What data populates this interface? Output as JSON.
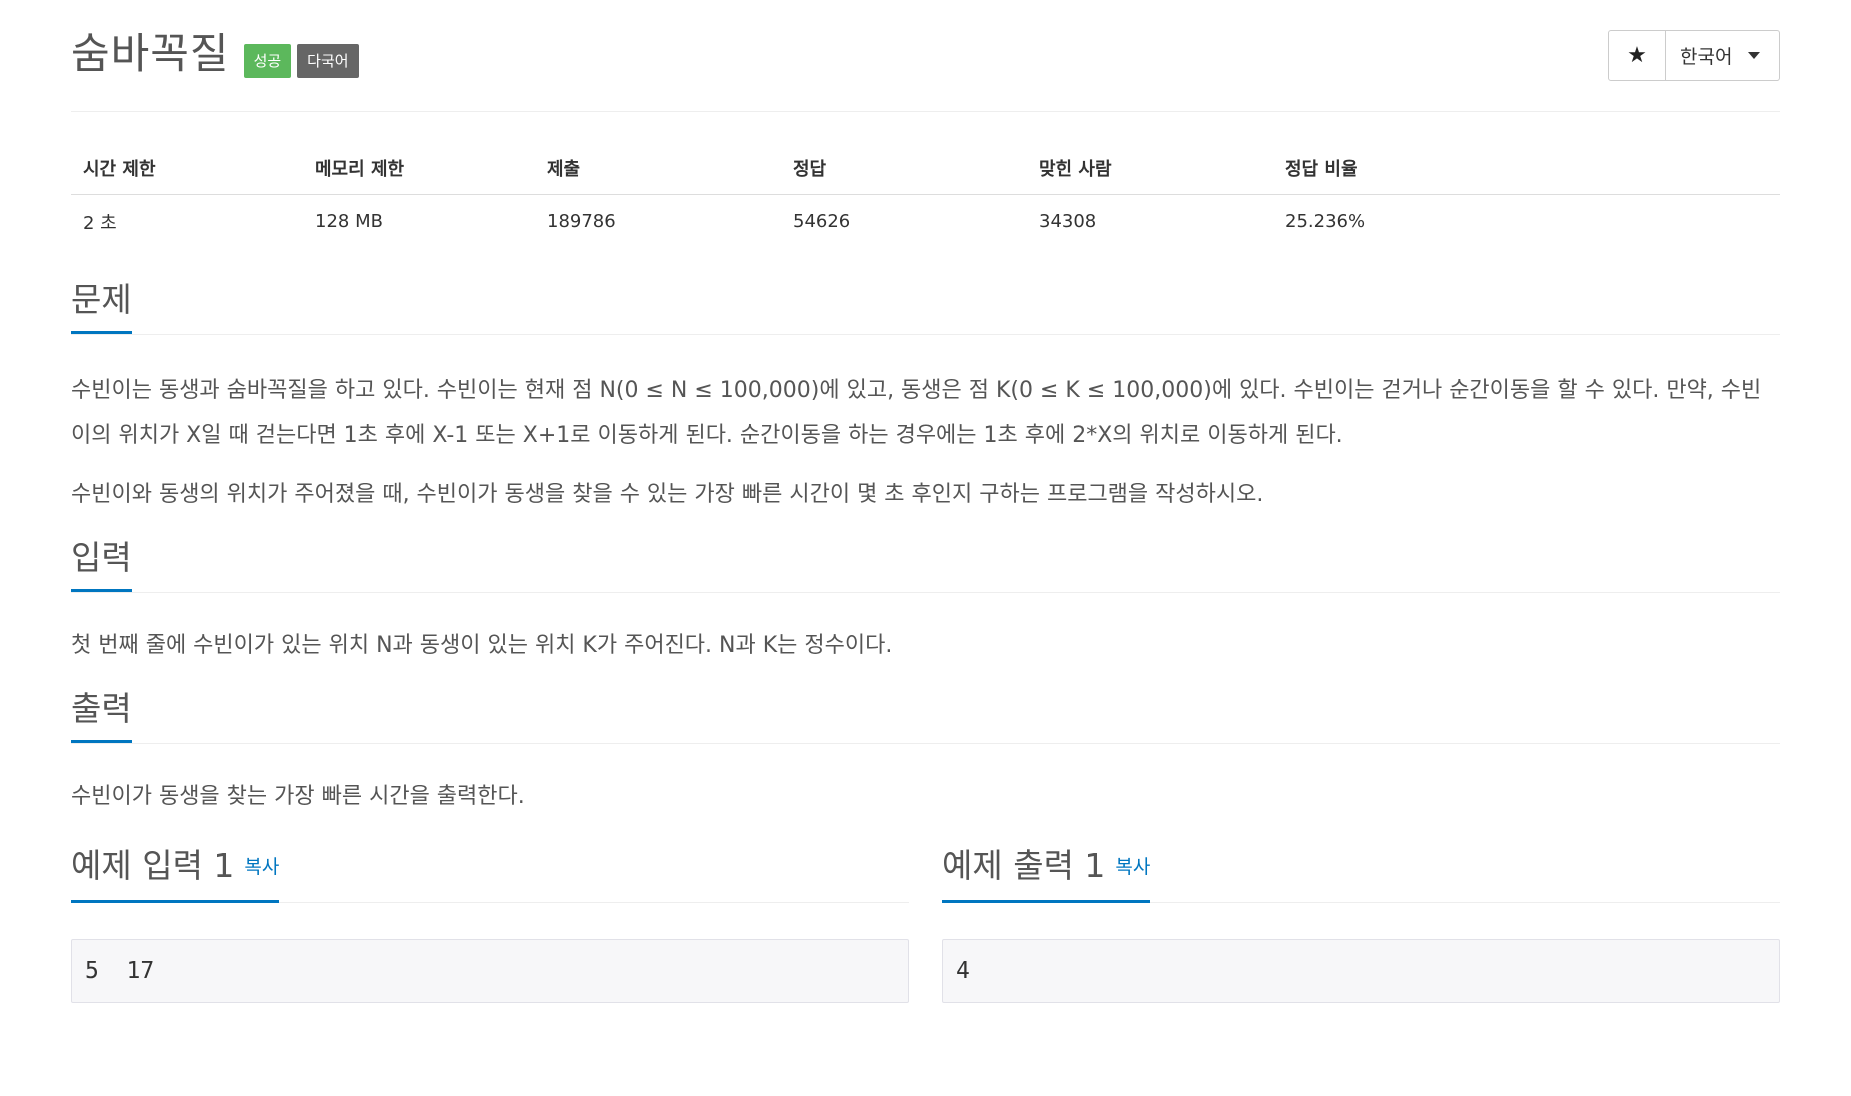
{
  "header": {
    "title": "숨바꼭질",
    "badge_success": "성공",
    "badge_multilang": "다국어",
    "star_icon": "★",
    "language_label": "한국어"
  },
  "info": {
    "headers": [
      "시간 제한",
      "메모리 제한",
      "제출",
      "정답",
      "맞힌 사람",
      "정답 비율"
    ],
    "values": [
      "2 초",
      "128 MB",
      "189786",
      "54626",
      "34308",
      "25.236%"
    ]
  },
  "problem": {
    "title": "문제",
    "paragraphs": [
      "수빈이는 동생과 숨바꼭질을 하고 있다. 수빈이는 현재 점 N(0 ≤ N ≤ 100,000)에 있고, 동생은 점 K(0 ≤ K ≤ 100,000)에 있다. 수빈이는 걷거나 순간이동을 할 수 있다. 만약, 수빈이의 위치가 X일 때 걷는다면 1초 후에 X-1 또는 X+1로 이동하게 된다. 순간이동을 하는 경우에는 1초 후에 2*X의 위치로 이동하게 된다.",
      "수빈이와 동생의 위치가 주어졌을 때, 수빈이가 동생을 찾을 수 있는 가장 빠른 시간이 몇 초 후인지 구하는 프로그램을 작성하시오."
    ]
  },
  "input": {
    "title": "입력",
    "text": "첫 번째 줄에 수빈이가 있는 위치 N과 동생이 있는 위치 K가 주어진다. N과 K는 정수이다."
  },
  "output": {
    "title": "출력",
    "text": "수빈이가 동생을 찾는 가장 빠른 시간을 출력한다."
  },
  "samples": {
    "input_title": "예제 입력 1",
    "output_title": "예제 출력 1",
    "copy_label": "복사",
    "input_value": "5  17",
    "output_value": "4"
  },
  "colors": {
    "success": "#5cb85c",
    "lang_badge": "#666666",
    "accent": "#0076c0"
  }
}
